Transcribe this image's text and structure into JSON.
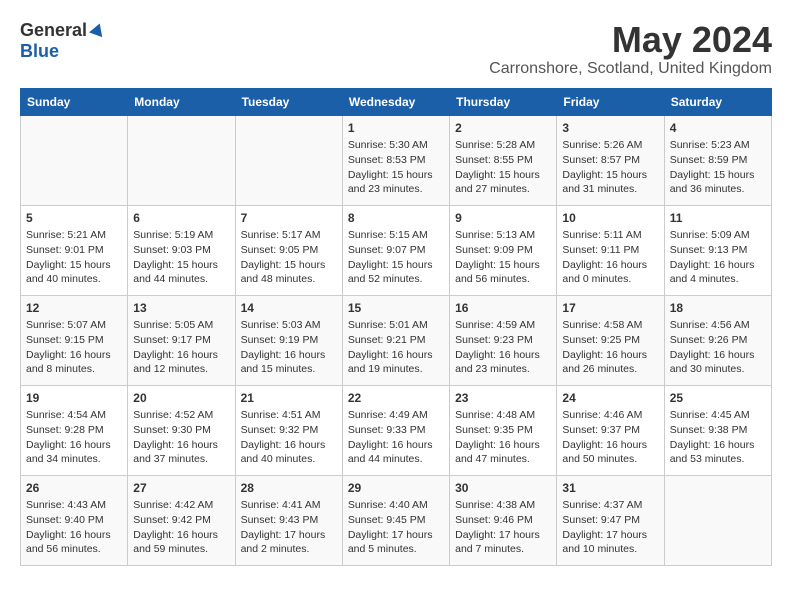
{
  "logo": {
    "general": "General",
    "blue": "Blue"
  },
  "title": "May 2024",
  "subtitle": "Carronshore, Scotland, United Kingdom",
  "weekdays": [
    "Sunday",
    "Monday",
    "Tuesday",
    "Wednesday",
    "Thursday",
    "Friday",
    "Saturday"
  ],
  "weeks": [
    [
      {
        "day": "",
        "info": ""
      },
      {
        "day": "",
        "info": ""
      },
      {
        "day": "",
        "info": ""
      },
      {
        "day": "1",
        "info": "Sunrise: 5:30 AM\nSunset: 8:53 PM\nDaylight: 15 hours\nand 23 minutes."
      },
      {
        "day": "2",
        "info": "Sunrise: 5:28 AM\nSunset: 8:55 PM\nDaylight: 15 hours\nand 27 minutes."
      },
      {
        "day": "3",
        "info": "Sunrise: 5:26 AM\nSunset: 8:57 PM\nDaylight: 15 hours\nand 31 minutes."
      },
      {
        "day": "4",
        "info": "Sunrise: 5:23 AM\nSunset: 8:59 PM\nDaylight: 15 hours\nand 36 minutes."
      }
    ],
    [
      {
        "day": "5",
        "info": "Sunrise: 5:21 AM\nSunset: 9:01 PM\nDaylight: 15 hours\nand 40 minutes."
      },
      {
        "day": "6",
        "info": "Sunrise: 5:19 AM\nSunset: 9:03 PM\nDaylight: 15 hours\nand 44 minutes."
      },
      {
        "day": "7",
        "info": "Sunrise: 5:17 AM\nSunset: 9:05 PM\nDaylight: 15 hours\nand 48 minutes."
      },
      {
        "day": "8",
        "info": "Sunrise: 5:15 AM\nSunset: 9:07 PM\nDaylight: 15 hours\nand 52 minutes."
      },
      {
        "day": "9",
        "info": "Sunrise: 5:13 AM\nSunset: 9:09 PM\nDaylight: 15 hours\nand 56 minutes."
      },
      {
        "day": "10",
        "info": "Sunrise: 5:11 AM\nSunset: 9:11 PM\nDaylight: 16 hours\nand 0 minutes."
      },
      {
        "day": "11",
        "info": "Sunrise: 5:09 AM\nSunset: 9:13 PM\nDaylight: 16 hours\nand 4 minutes."
      }
    ],
    [
      {
        "day": "12",
        "info": "Sunrise: 5:07 AM\nSunset: 9:15 PM\nDaylight: 16 hours\nand 8 minutes."
      },
      {
        "day": "13",
        "info": "Sunrise: 5:05 AM\nSunset: 9:17 PM\nDaylight: 16 hours\nand 12 minutes."
      },
      {
        "day": "14",
        "info": "Sunrise: 5:03 AM\nSunset: 9:19 PM\nDaylight: 16 hours\nand 15 minutes."
      },
      {
        "day": "15",
        "info": "Sunrise: 5:01 AM\nSunset: 9:21 PM\nDaylight: 16 hours\nand 19 minutes."
      },
      {
        "day": "16",
        "info": "Sunrise: 4:59 AM\nSunset: 9:23 PM\nDaylight: 16 hours\nand 23 minutes."
      },
      {
        "day": "17",
        "info": "Sunrise: 4:58 AM\nSunset: 9:25 PM\nDaylight: 16 hours\nand 26 minutes."
      },
      {
        "day": "18",
        "info": "Sunrise: 4:56 AM\nSunset: 9:26 PM\nDaylight: 16 hours\nand 30 minutes."
      }
    ],
    [
      {
        "day": "19",
        "info": "Sunrise: 4:54 AM\nSunset: 9:28 PM\nDaylight: 16 hours\nand 34 minutes."
      },
      {
        "day": "20",
        "info": "Sunrise: 4:52 AM\nSunset: 9:30 PM\nDaylight: 16 hours\nand 37 minutes."
      },
      {
        "day": "21",
        "info": "Sunrise: 4:51 AM\nSunset: 9:32 PM\nDaylight: 16 hours\nand 40 minutes."
      },
      {
        "day": "22",
        "info": "Sunrise: 4:49 AM\nSunset: 9:33 PM\nDaylight: 16 hours\nand 44 minutes."
      },
      {
        "day": "23",
        "info": "Sunrise: 4:48 AM\nSunset: 9:35 PM\nDaylight: 16 hours\nand 47 minutes."
      },
      {
        "day": "24",
        "info": "Sunrise: 4:46 AM\nSunset: 9:37 PM\nDaylight: 16 hours\nand 50 minutes."
      },
      {
        "day": "25",
        "info": "Sunrise: 4:45 AM\nSunset: 9:38 PM\nDaylight: 16 hours\nand 53 minutes."
      }
    ],
    [
      {
        "day": "26",
        "info": "Sunrise: 4:43 AM\nSunset: 9:40 PM\nDaylight: 16 hours\nand 56 minutes."
      },
      {
        "day": "27",
        "info": "Sunrise: 4:42 AM\nSunset: 9:42 PM\nDaylight: 16 hours\nand 59 minutes."
      },
      {
        "day": "28",
        "info": "Sunrise: 4:41 AM\nSunset: 9:43 PM\nDaylight: 17 hours\nand 2 minutes."
      },
      {
        "day": "29",
        "info": "Sunrise: 4:40 AM\nSunset: 9:45 PM\nDaylight: 17 hours\nand 5 minutes."
      },
      {
        "day": "30",
        "info": "Sunrise: 4:38 AM\nSunset: 9:46 PM\nDaylight: 17 hours\nand 7 minutes."
      },
      {
        "day": "31",
        "info": "Sunrise: 4:37 AM\nSunset: 9:47 PM\nDaylight: 17 hours\nand 10 minutes."
      },
      {
        "day": "",
        "info": ""
      }
    ]
  ]
}
